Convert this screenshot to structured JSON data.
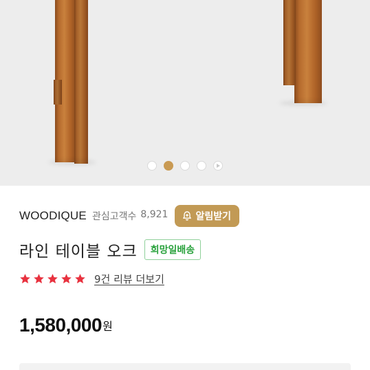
{
  "product_image": {
    "carousel_total": 5,
    "carousel_active_index": 1
  },
  "brand": {
    "name": "WOODIQUE",
    "fans_label": "관심고객수",
    "fans_count": "8,921",
    "alert_label": "알림받기"
  },
  "product": {
    "title": "라인 테이블 오크",
    "delivery_tag": "희망일배송"
  },
  "rating": {
    "stars": 5,
    "review_link": "9건 리뷰 더보기"
  },
  "price": {
    "amount": "1,580,000",
    "currency": "원"
  },
  "colors": {
    "accent_gold": "#c29a55",
    "star_red": "#e8323f",
    "tag_green": "#2aa23d"
  }
}
